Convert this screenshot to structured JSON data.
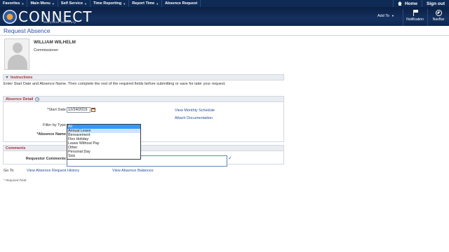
{
  "menubar": {
    "items": [
      {
        "label": "Favorites"
      },
      {
        "label": "Main Menu"
      },
      {
        "label": "Self Service"
      },
      {
        "label": "Time Reporting"
      },
      {
        "label": "Report Time"
      },
      {
        "label": "Absence Request"
      }
    ],
    "home_label": "Home",
    "signout_label": "Sign out"
  },
  "header": {
    "logo_text": "CONNECT",
    "logo_subtitle": "Maryland Judiciary",
    "add_to_label": "Add To",
    "notification_label": "Notification",
    "navbar_label": "NavBar"
  },
  "page": {
    "title": "Request Absence"
  },
  "employee": {
    "name": "WILLIAM WILHELM",
    "title": "Commissioner"
  },
  "instructions": {
    "header": "Instructions",
    "text": "Enter Start Date and Absence Name. Then complete the rest of the required fields before submitting or save for later your request."
  },
  "absence_detail": {
    "header": "Absence Detail",
    "start_date_label": "*Start Date",
    "start_date_value": "12/24/2015",
    "filter_label": "Filter by Type",
    "absence_name_label": "*Absence Name",
    "links": {
      "monthly_schedule": "View Monthly Schedule",
      "attach_documentation": "Attach Documentation"
    },
    "dropdown_options": [
      {
        "label": "All",
        "state": "selected"
      },
      {
        "label": "Annual Leave",
        "state": "hover"
      },
      {
        "label": "Bereavement",
        "state": ""
      },
      {
        "label": "Flex Holiday",
        "state": ""
      },
      {
        "label": "Leave Without Pay",
        "state": ""
      },
      {
        "label": "Other",
        "state": ""
      },
      {
        "label": "Personal Day",
        "state": ""
      },
      {
        "label": "Sick",
        "state": ""
      }
    ]
  },
  "comments": {
    "header": "Comments",
    "requestor_label": "Requestor Comments",
    "value": ""
  },
  "goto": {
    "label": "Go To",
    "history_link": "View Absence Request History",
    "balances_link": "View Absence Balances"
  },
  "footer": {
    "required_note": "* Required Field"
  },
  "colors": {
    "menubar": "#0e2a55",
    "link": "#1f4e96",
    "section_header_text": "#a6333a",
    "selected_option": "#3399ff"
  }
}
